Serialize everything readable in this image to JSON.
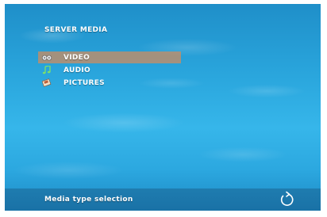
{
  "screen": {
    "title": "SERVER MEDIA"
  },
  "menu": {
    "items": [
      {
        "label": "VIDEO",
        "icon": "film-reel-icon",
        "selected": true
      },
      {
        "label": "AUDIO",
        "icon": "music-note-icon",
        "selected": false
      },
      {
        "label": "PICTURES",
        "icon": "picture-icon",
        "selected": false
      }
    ]
  },
  "footer": {
    "status": "Media type selection",
    "back_icon": "back-arrow-icon"
  },
  "colors": {
    "highlight": "#cd8c5f",
    "text": "#ffffff"
  }
}
